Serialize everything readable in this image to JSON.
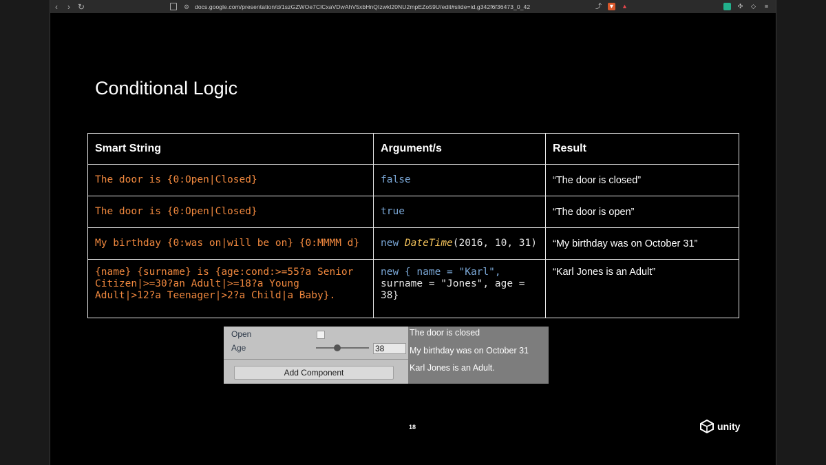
{
  "browser": {
    "url": "docs.google.com/presentation/d/1szGZWOe7ClCxaVDwAhV5xbHnQIzwkl20NU2mpEZo59U/edit#slide=id.g342f6f36473_0_42",
    "back_icon": "‹",
    "forward_icon": "›",
    "reload_icon": "↻"
  },
  "slide": {
    "title": "Conditional Logic",
    "page_number": "18",
    "logo_text": "unity"
  },
  "table": {
    "headers": [
      "Smart String",
      "Argument/s",
      "Result"
    ],
    "rows": [
      {
        "smart": "The door is {0:Open|Closed}",
        "arg_kw": "false",
        "result": "“The door is closed”"
      },
      {
        "smart": "The door is {0:Open|Closed}",
        "arg_kw": "true",
        "result": "“The door is open”"
      },
      {
        "smart": "My birthday {0:was on|will be on} {0:MMMM d}",
        "arg_kw": "new",
        "arg_type": "DateTime",
        "arg_rest": "(2016, 10, 31)",
        "result": "“My birthday was on October 31”"
      },
      {
        "smart_lines": [
          "{name} {surname} is {age:cond:>=55?a Senior",
          "Citizen|>=30?an Adult|>=18?a Young",
          "Adult|>12?a Teenager|>2?a Child|a Baby}."
        ],
        "arg_lines": [
          "new { name = \"Karl\",",
          "surname = \"Jones\", age =",
          "38}"
        ],
        "result": "“Karl Jones is an Adult”"
      }
    ]
  },
  "unity_inspector": {
    "open_label": "Open",
    "age_label": "Age",
    "age_value": "38",
    "age_slider_fraction": 0.4,
    "add_component_label": "Add Component",
    "outputs": [
      "The door is closed",
      "My birthday was on October 31",
      "Karl Jones is an Adult."
    ]
  },
  "colors": {
    "code_orange": "#f0883e",
    "keyword_blue": "#7aa7d6",
    "type_yellow": "#f0c05a"
  }
}
